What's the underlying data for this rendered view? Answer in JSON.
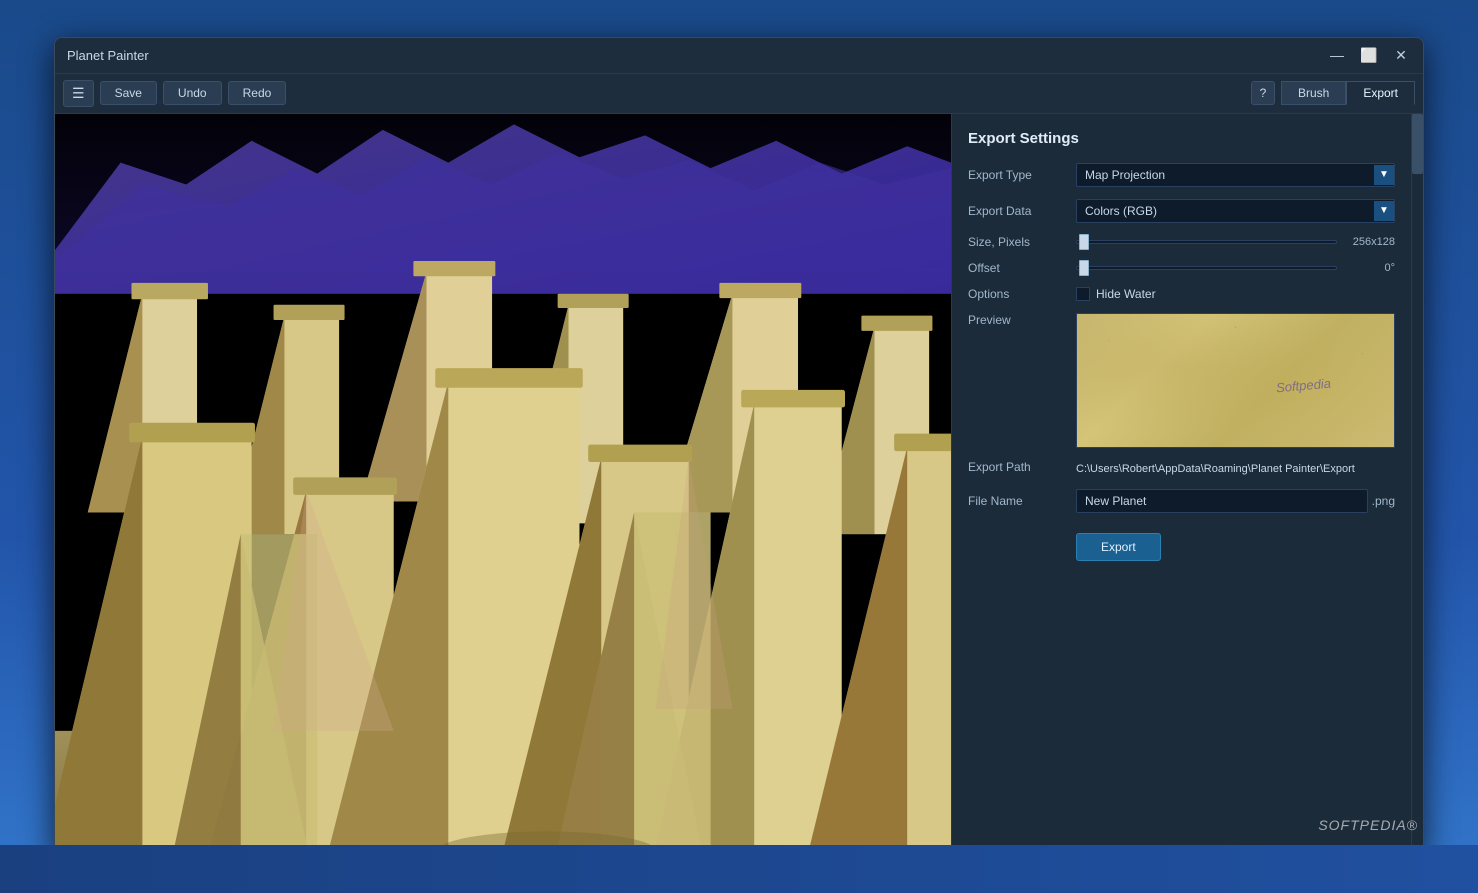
{
  "window": {
    "title": "Planet Painter"
  },
  "titlebar": {
    "minimize_label": "—",
    "maximize_label": "⬜",
    "close_label": "✕"
  },
  "toolbar": {
    "menu_icon": "☰",
    "save_label": "Save",
    "undo_label": "Undo",
    "redo_label": "Redo",
    "help_label": "?"
  },
  "tabs": {
    "brush_label": "Brush",
    "export_label": "Export"
  },
  "export_settings": {
    "title": "Export Settings",
    "export_type_label": "Export Type",
    "export_type_value": "Map Projection",
    "export_data_label": "Export Data",
    "export_data_value": "Colors (RGB)",
    "size_pixels_label": "Size, Pixels",
    "size_pixels_value": "256x128",
    "offset_label": "Offset",
    "offset_value": "0°",
    "options_label": "Options",
    "hide_water_label": "Hide Water",
    "preview_label": "Preview",
    "preview_watermark": "Softpedia",
    "export_path_label": "Export Path",
    "export_path_value": "C:\\Users\\Robert\\AppData\\Roaming\\Planet Painter\\Export",
    "file_name_label": "File Name",
    "file_name_value": "New Planet",
    "file_ext": ".png",
    "export_button_label": "Export"
  },
  "softpedia": {
    "watermark": "SOFTPEDIA®"
  },
  "colors": {
    "accent_blue": "#1a6090",
    "dropdown_arrow": "#1a5080",
    "preview_bg": "#c8b870",
    "panel_bg": "#1c2b3a",
    "toolbar_bg": "#1e2d3d"
  }
}
